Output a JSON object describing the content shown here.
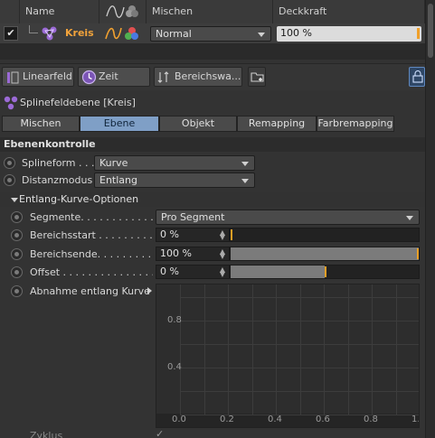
{
  "layer_list": {
    "headers": {
      "name": "Name",
      "mischen": "Mischen",
      "deckkraft": "Deckkraft"
    },
    "rows": [
      {
        "checked": "✔",
        "name": "Kreis",
        "blend_mode": "Normal",
        "opacity": "100 %"
      }
    ]
  },
  "toolbar": {
    "buttons": [
      {
        "label": "Linearfeld",
        "icon": "linear-field-icon"
      },
      {
        "label": "Zeit",
        "icon": "clock-icon"
      },
      {
        "label": "Bereichswa...",
        "icon": "range-map-icon"
      }
    ]
  },
  "object_title": "Splinefeldebene [Kreis]",
  "tabs": [
    "Mischen",
    "Ebene",
    "Objekt",
    "Remapping",
    "Farbremapping"
  ],
  "active_tab": "Ebene",
  "section": {
    "title": "Ebenenkontrolle",
    "params": [
      {
        "label": "Splineform . . .",
        "value": "Kurve"
      },
      {
        "label": "Distanzmodus",
        "value": "Entlang"
      }
    ]
  },
  "subsection": {
    "title": "Entlang-Kurve-Optionen",
    "segmente": {
      "label": "Segmente. . . . . . . . . . . . . .",
      "value": "Pro Segment"
    },
    "bereichsstart": {
      "label": "Bereichsstart . . . . . . . . . .",
      "value": "0 %",
      "level": 0.0
    },
    "bereichsende": {
      "label": "Bereichsende. . . . . . . . . .",
      "value": "100 %",
      "level": 1.0
    },
    "offset": {
      "label": "Offset . . . . . . . . . . . . . . .",
      "value": "0 %",
      "level": 0.5
    },
    "abnahme": {
      "label": "Abnahme entlang Kurve"
    }
  },
  "graph": {
    "y_labels": [
      "0.8",
      "0.4"
    ],
    "x_labels": [
      "0.0",
      "0.2",
      "0.4",
      "0.6",
      "0.8",
      "1."
    ]
  },
  "bottom": {
    "label": "Zyklus"
  },
  "colors": {
    "accent": "#f2a33b",
    "active_tab": "#7f9fc6",
    "marker": "#e89f25"
  }
}
